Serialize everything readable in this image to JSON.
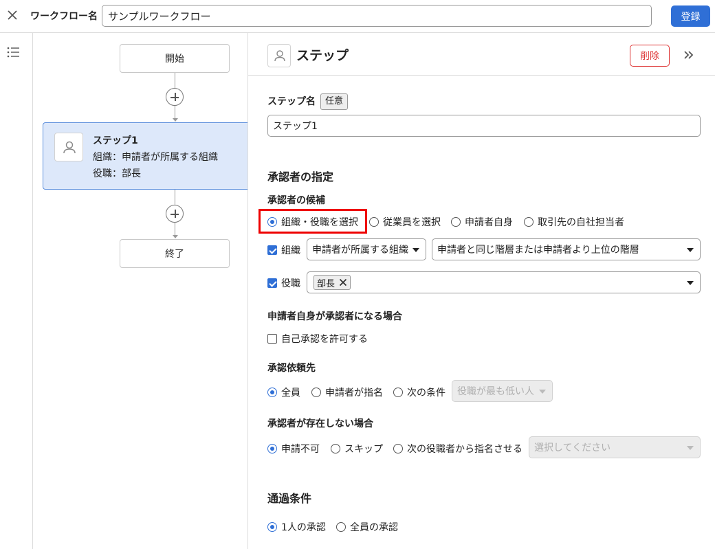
{
  "topbar": {
    "workflow_label": "ワークフロー名",
    "workflow_name": "サンプルワークフロー",
    "register_label": "登録"
  },
  "flow": {
    "start_label": "開始",
    "end_label": "終了",
    "step": {
      "title": "ステップ1",
      "org_line": "組織：申請者が所属する組織",
      "role_line": "役職：部長"
    }
  },
  "panel": {
    "title": "ステップ",
    "delete_label": "削除",
    "step_name": {
      "label": "ステップ名",
      "tag": "任意",
      "value": "ステップ1"
    },
    "approver_section": {
      "heading": "承認者の指定",
      "candidates_label": "承認者の候補",
      "candidate_options": [
        "組織・役職を選択",
        "従業員を選択",
        "申請者自身",
        "取引先の自社担当者"
      ],
      "selected_candidate": "組織・役職を選択",
      "org": {
        "label": "組織",
        "checked": true,
        "scope_value": "申請者が所属する組織",
        "level_value": "申請者と同じ階層または申請者より上位の階層"
      },
      "role": {
        "label": "役職",
        "checked": true,
        "chips": [
          "部長"
        ]
      }
    },
    "self_approval": {
      "label": "申請者自身が承認者になる場合",
      "checkbox_label": "自己承認を許可する",
      "checked": false
    },
    "request_target": {
      "label": "承認依頼先",
      "options": [
        "全員",
        "申請者が指名",
        "次の条件"
      ],
      "selected": "全員",
      "condition_value": "役職が最も低い人"
    },
    "no_approver": {
      "label": "承認者が存在しない場合",
      "options": [
        "申請不可",
        "スキップ",
        "次の役職者から指名させる"
      ],
      "selected": "申請不可",
      "select_placeholder": "選択してください"
    },
    "pass_condition": {
      "heading": "通過条件",
      "options": [
        "1人の承認",
        "全員の承認"
      ],
      "selected": "1人の承認"
    }
  },
  "colors": {
    "accent": "#2f6fd6",
    "danger": "#dd3333",
    "highlight": "#ee0000",
    "step_card_bg": "#dde8fa"
  }
}
